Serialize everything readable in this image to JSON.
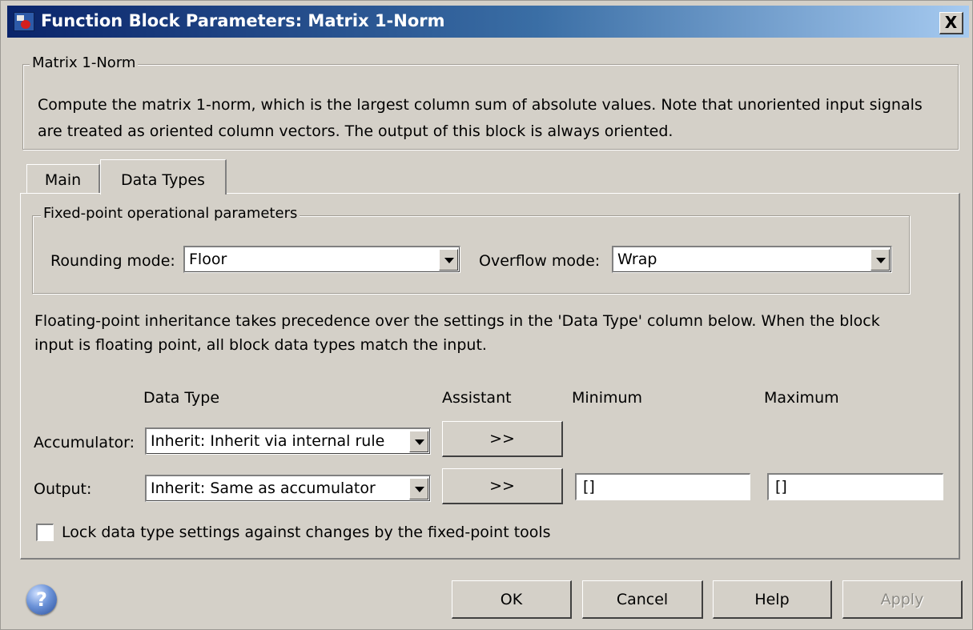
{
  "window": {
    "title": "Function Block Parameters: Matrix 1-Norm",
    "close_label": "X"
  },
  "description_group": {
    "legend": "Matrix 1-Norm",
    "text": "Compute the matrix 1-norm, which is the largest column sum of absolute values. Note that unoriented input signals are treated as oriented column vectors. The output of this block is always oriented."
  },
  "tabs": [
    {
      "label": "Main",
      "active": false
    },
    {
      "label": "Data Types",
      "active": true
    }
  ],
  "fixed_point": {
    "legend": "Fixed-point operational parameters",
    "rounding_label": "Rounding mode:",
    "rounding_value": "Floor",
    "overflow_label": "Overflow mode:",
    "overflow_value": "Wrap"
  },
  "note": "Floating-point inheritance takes precedence over the settings in the 'Data Type' column below. When the block input is floating point, all block data types match the input.",
  "table": {
    "headers": {
      "data_type": "Data Type",
      "assistant": "Assistant",
      "minimum": "Minimum",
      "maximum": "Maximum"
    },
    "rows": [
      {
        "label": "Accumulator:",
        "data_type": "Inherit: Inherit via internal rule",
        "assistant": ">>"
      },
      {
        "label": "Output:",
        "data_type": "Inherit: Same as accumulator",
        "assistant": ">>",
        "minimum": "[]",
        "maximum": "[]"
      }
    ]
  },
  "lock_checkbox": {
    "label": "Lock data type settings against changes by the fixed-point tools",
    "checked": false
  },
  "buttons": {
    "ok": "OK",
    "cancel": "Cancel",
    "help": "Help",
    "apply": "Apply"
  },
  "help_icon": "?",
  "colors": {
    "dialog_bg": "#d4d0c8",
    "title_start": "#0a246a",
    "title_end": "#a6caf0"
  }
}
